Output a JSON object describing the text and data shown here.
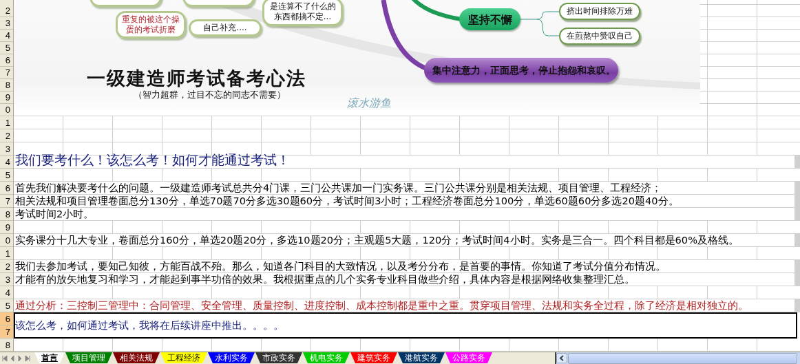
{
  "mind_map": {
    "nodes": [
      {
        "kind": "bubble",
        "text": "是连算不了什么的东西都搞不定..."
      },
      {
        "kind": "red-bubble",
        "text": "重复的被这个操蛋的考试折磨"
      },
      {
        "kind": "bubble",
        "text": "自己补充...."
      },
      {
        "kind": "green-node",
        "text": "坚持不懈"
      },
      {
        "kind": "leaf",
        "text": "挤出时间排除万难"
      },
      {
        "kind": "leaf",
        "text": "在煎熬中赞叹自己"
      },
      {
        "kind": "purple-node",
        "text": "集中注意力，正面思考，停止抱怨和哀叹。"
      }
    ],
    "title": "一级建造师考试备考心法",
    "subtitle": "（智力超群，过目不忘的同志不需要）",
    "signature": "滚水游鱼"
  },
  "sheet": {
    "rows": [
      {
        "headers": [
          "2"
        ],
        "selected": false
      },
      {
        "headers": [
          "3"
        ],
        "selected": false
      },
      {
        "headers": [
          "4"
        ],
        "selected": false
      },
      {
        "headers": [
          "5"
        ],
        "selected": false
      },
      {
        "headers": [
          "6"
        ],
        "selected": false
      },
      {
        "headers": [
          "7"
        ],
        "selected": false
      },
      {
        "headers": [
          "8"
        ],
        "selected": false
      },
      {
        "headers": [
          "9"
        ],
        "selected": false
      },
      {
        "headers": [
          "0"
        ],
        "selected": false
      },
      {
        "headers": [
          "1"
        ],
        "selected": false
      },
      {
        "headers": [
          "2"
        ],
        "selected": false
      },
      {
        "headers": [
          "3"
        ],
        "selected": false
      },
      {
        "headers": [
          "4"
        ],
        "selected": false,
        "kind": "heading",
        "text": "我们要考什么！该怎么考！如何才能通过考试！"
      },
      {
        "headers": [
          "5"
        ],
        "selected": false
      },
      {
        "headers": [
          "6"
        ],
        "selected": false,
        "kind": "body",
        "text": "首先我们解决要考什么的问题。一级建造师考试总共分4门课，三门公共课加一门实务课。三门公共课分别是相关法规、项目管理、工程经济；"
      },
      {
        "headers": [
          "7"
        ],
        "selected": false,
        "kind": "body",
        "text": "相关法规和项目管理卷面总分130分，单选70题70分多选30题60分，考试时间3小时；工程经济卷面总分100分，单选60题60分多选20题40分。"
      },
      {
        "headers": [
          "8"
        ],
        "selected": false,
        "kind": "body",
        "text": "考试时间2小时。"
      },
      {
        "headers": [
          "9"
        ],
        "selected": false
      },
      {
        "headers": [
          "0"
        ],
        "selected": false,
        "kind": "body",
        "text": "实务课分十几大专业，卷面总分160分，单选20题20分，多选10题20分；主观题5大题，120分；考试时间4小时。实务是三合一。四个科目都是60%及格线。"
      },
      {
        "headers": [
          "1"
        ],
        "selected": false
      },
      {
        "headers": [
          "2"
        ],
        "selected": false,
        "kind": "body",
        "text": "我们去参加考试，要知己知彼，方能百战不殆。那么，知道各门科目的大致情况，以及考分分布，是首要的事情。你知道了考试分值分布情况。"
      },
      {
        "headers": [
          "3"
        ],
        "selected": false,
        "kind": "body",
        "text": "才能有的放矢地复习和学习，才能起到事半功倍的效果。我根据重点的几个实务专业科目做些介绍，具体内容是根据网络收集整理汇总。"
      },
      {
        "headers": [
          "4"
        ],
        "selected": false
      },
      {
        "headers": [
          "5"
        ],
        "selected": false,
        "kind": "note",
        "text": "通过分析：三控制三管理中：合同管理、安全管理、质量控制、进度控制、成本控制都是重中之重。贯穿项目管理、法规和实务全过程，除了经济是相对独立的。"
      },
      {
        "headers": [
          "6",
          "7"
        ],
        "selected": true,
        "kind": "merged",
        "text": "该怎么考，如何通过考试，我将在后续讲座中推出。。。。"
      },
      {
        "headers": [
          "8"
        ],
        "selected": false
      }
    ]
  },
  "sheet_tabs": [
    {
      "label": "首言",
      "selected": true,
      "color": "#ffffff"
    },
    {
      "label": "项目管理",
      "selected": false,
      "color": "#008000"
    },
    {
      "label": "相关法规",
      "selected": false,
      "color": "#800000"
    },
    {
      "label": "工程经济",
      "selected": false,
      "color": "#ffff00"
    },
    {
      "label": "水利实务",
      "selected": false,
      "color": "#0000ff"
    },
    {
      "label": "市政实务",
      "selected": false,
      "color": "#333333"
    },
    {
      "label": "机电实务",
      "selected": false,
      "color": "#00cc00"
    },
    {
      "label": "建筑实务",
      "selected": false,
      "color": "#ff0000"
    },
    {
      "label": "港航实务",
      "selected": false,
      "color": "#003366"
    },
    {
      "label": "公路实务",
      "selected": false,
      "color": "#ff00ff"
    }
  ]
}
